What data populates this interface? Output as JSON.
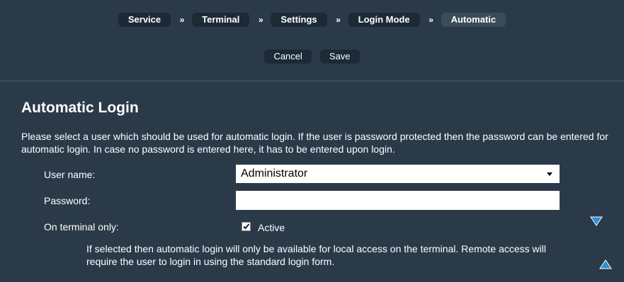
{
  "breadcrumb": {
    "items": [
      "Service",
      "Terminal",
      "Settings",
      "Login Mode",
      "Automatic"
    ],
    "separator": "»"
  },
  "actions": {
    "cancel_label": "Cancel",
    "save_label": "Save"
  },
  "page": {
    "title": "Automatic Login",
    "description": "Please select a user which should be used for automatic login. If the user is password protected then the password can be entered for automatic login. In case no password is entered here, it has to be entered upon login."
  },
  "form": {
    "username_label": "User name:",
    "username_value": "Administrator",
    "password_label": "Password:",
    "password_value": "",
    "terminal_only_label": "On terminal only:",
    "active_label": "Active",
    "active_checked": true,
    "note": "If selected then automatic login will only be available for local access on the terminal. Remote access will require the user to login in using the standard login form."
  },
  "icons": {
    "scroll_down": "triangle-down-icon",
    "scroll_up": "triangle-up-icon"
  },
  "colors": {
    "background": "#2a3a49",
    "button": "#1c2a36",
    "accent": "#2e8fd0"
  }
}
